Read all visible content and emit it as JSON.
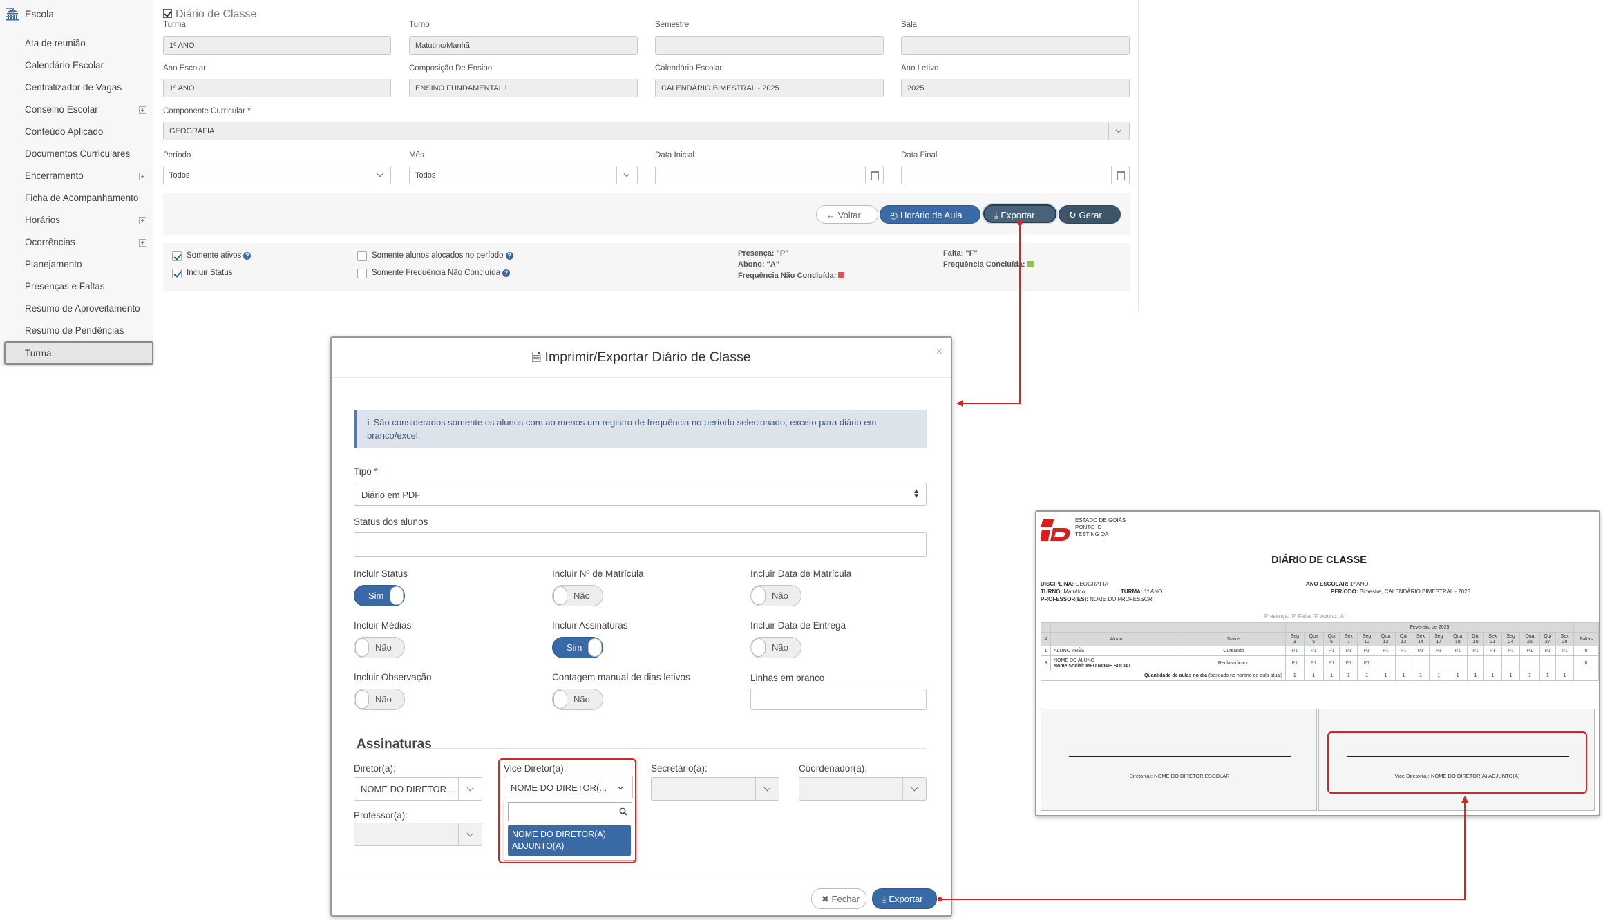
{
  "sidebar": {
    "header": "Escola",
    "items": [
      {
        "label": "Ata de reunião",
        "expandable": false
      },
      {
        "label": "Calendário Escolar",
        "expandable": false
      },
      {
        "label": "Centralizador de Vagas",
        "expandable": false
      },
      {
        "label": "Conselho Escolar",
        "expandable": true
      },
      {
        "label": "Conteúdo Aplicado",
        "expandable": false
      },
      {
        "label": "Documentos Curriculares",
        "expandable": false
      },
      {
        "label": "Encerramento",
        "expandable": true
      },
      {
        "label": "Ficha de Acompanhamento",
        "expandable": false
      },
      {
        "label": "Horários",
        "expandable": true
      },
      {
        "label": "Ocorrências",
        "expandable": true
      },
      {
        "label": "Planejamento",
        "expandable": false
      },
      {
        "label": "Presenças e Faltas",
        "expandable": false
      },
      {
        "label": "Resumo de Aproveitamento",
        "expandable": false
      },
      {
        "label": "Resumo de Pendências",
        "expandable": false
      }
    ],
    "active_item": "Turma"
  },
  "form": {
    "title": "Diário de Classe",
    "turma": {
      "label": "Turma",
      "value": "1º ANO"
    },
    "turno": {
      "label": "Turno",
      "value": "Matutino/Manhã"
    },
    "semestre": {
      "label": "Semestre",
      "value": ""
    },
    "sala": {
      "label": "Sala",
      "value": ""
    },
    "ano_escolar": {
      "label": "Ano Escolar",
      "value": "1º ANO"
    },
    "composicao": {
      "label": "Composição De Ensino",
      "value": "ENSINO FUNDAMENTAL I"
    },
    "calendario": {
      "label": "Calendário Escolar",
      "value": "CALENDÁRIO BIMESTRAL - 2025"
    },
    "ano_letivo": {
      "label": "Ano Letivo",
      "value": "2025"
    },
    "componente": {
      "label": "Componente Curricular",
      "required_mark": "*",
      "value": "GEOGRAFIA"
    },
    "periodo": {
      "label": "Período",
      "value": "Todos"
    },
    "mes": {
      "label": "Mês",
      "value": "Todos"
    },
    "data_inicial": {
      "label": "Data Inicial",
      "value": ""
    },
    "data_final": {
      "label": "Data Final",
      "value": ""
    }
  },
  "buttons": {
    "voltar": "Voltar",
    "horario": "Horário de Aula",
    "exportar": "Exportar",
    "gerar": "Gerar"
  },
  "options": {
    "somente_ativos": {
      "label": "Somente ativos",
      "checked": true
    },
    "incluir_status": {
      "label": "Incluir Status",
      "checked": true
    },
    "somente_alocados": {
      "label": "Somente alunos alocados no período",
      "checked": false
    },
    "somente_freq": {
      "label": "Somente Frequência Não Concluída",
      "checked": false
    }
  },
  "legend": {
    "presenca": "Presença: \"P\"",
    "abono": "Abono: \"A\"",
    "freq_nao_concluida": "Frequência Não Concluída:",
    "falta": "Falta: \"F\"",
    "freq_concluida": "Frequência Concluída:",
    "color_nao_concluida": "#e05252",
    "color_concluida": "#8dc63f"
  },
  "modal": {
    "title": "Imprimir/Exportar Diário de Classe",
    "close": "×",
    "info": "São considerados somente os alunos com ao menos um registro de frequência no período selecionado, exceto para diário em branco/excel.",
    "tipo": {
      "label": "Tipo",
      "required_mark": "*",
      "value": "Diário em PDF"
    },
    "status_alunos": {
      "label": "Status dos alunos",
      "value": ""
    },
    "toggles": [
      {
        "label": "Incluir Status",
        "value": "Sim",
        "on": true
      },
      {
        "label": "Incluir Nº de Matrícula",
        "value": "Não",
        "on": false
      },
      {
        "label": "Incluir Data de Matrícula",
        "value": "Não",
        "on": false
      },
      {
        "label": "Incluir Médias",
        "value": "Não",
        "on": false
      },
      {
        "label": "Incluir Assinaturas",
        "value": "Sim",
        "on": true
      },
      {
        "label": "Incluir Data de Entrega",
        "value": "Não",
        "on": false
      },
      {
        "label": "Incluir Observação",
        "value": "Não",
        "on": false
      },
      {
        "label": "Contagem manual de dias letivos",
        "value": "Não",
        "on": false
      }
    ],
    "linhas_branco": {
      "label": "Linhas em branco",
      "value": ""
    },
    "assinaturas": {
      "title": "Assinaturas",
      "diretor": {
        "label": "Diretor(a):",
        "value": "NOME DO DIRETOR ..."
      },
      "vice": {
        "label": "Vice Diretor(a):",
        "value": "NOME DO DIRETOR(..."
      },
      "secretario": {
        "label": "Secretário(a):",
        "value": ""
      },
      "coordenador": {
        "label": "Coordenador(a):",
        "value": ""
      },
      "professor": {
        "label": "Professor(a):",
        "value": ""
      },
      "dropdown_option": "NOME DO DIRETOR(A) ADJUNTO(A)"
    },
    "fechar": "Fechar",
    "exportar": "Exportar"
  },
  "report": {
    "header_lines": [
      "ESTADO DE GOIÁS",
      "PONTO ID",
      "TESTING QA"
    ],
    "title": "DIÁRIO DE CLASSE",
    "disciplina_label": "DISCIPLINA:",
    "disciplina": "GEOGRAFIA",
    "ano_escolar_label": "ANO ESCOLAR:",
    "ano_escolar": "1º ANO",
    "turno_label": "TURNO:",
    "turno": "Matutino",
    "turma_label": "TURMA:",
    "turma": "1º ANO",
    "periodo_label": "PERÍODO:",
    "periodo": "Bimestre, CALENDÁRIO BIMESTRAL - 2025",
    "professor_label": "PROFESSOR(ES):",
    "professor": "NOME DO PROFESSOR",
    "legend_line": "Presença: 'P'     Falta: 'F'     Abono: 'A'",
    "month": "Fevereiro de 2025",
    "col_num": "#",
    "col_aluno": "Aluno",
    "col_status": "Status",
    "col_faltas": "Faltas",
    "days": [
      {
        "w": "Seg",
        "d": "3"
      },
      {
        "w": "Qua",
        "d": "5"
      },
      {
        "w": "Qui",
        "d": "6"
      },
      {
        "w": "Sex",
        "d": "7"
      },
      {
        "w": "Seg",
        "d": "10"
      },
      {
        "w": "Qua",
        "d": "12"
      },
      {
        "w": "Qui",
        "d": "13"
      },
      {
        "w": "Sex",
        "d": "14"
      },
      {
        "w": "Seg",
        "d": "17"
      },
      {
        "w": "Qua",
        "d": "19"
      },
      {
        "w": "Qui",
        "d": "20"
      },
      {
        "w": "Sex",
        "d": "21"
      },
      {
        "w": "Seg",
        "d": "24"
      },
      {
        "w": "Qua",
        "d": "26"
      },
      {
        "w": "Qui",
        "d": "27"
      },
      {
        "w": "Sex",
        "d": "28"
      }
    ],
    "rows": [
      {
        "num": "1",
        "aluno": "ALUNO TRÊS",
        "social": "",
        "status": "Cursando",
        "marks": [
          "P1",
          "P1",
          "P1",
          "P1",
          "P1",
          "P1",
          "P1",
          "P1",
          "P1",
          "P1",
          "P1",
          "P1",
          "P1",
          "P1",
          "P1",
          "P1"
        ],
        "faltas": "0"
      },
      {
        "num": "3",
        "aluno": "NOME DO ALUNO",
        "social": "Nome Social: MEU NOME SOCIAL",
        "status": "Reclassificado",
        "marks": [
          "P1",
          "P1",
          "P1",
          "P1",
          "P1",
          "",
          "",
          "",
          "",
          "",
          "",
          "",
          "",
          "",
          "",
          ""
        ],
        "faltas": "0"
      }
    ],
    "qtd_label": "Quantidade de aulas no dia",
    "qtd_note": "(baseado no horário de aula atual)",
    "qtd_values": [
      "1",
      "1",
      "1",
      "1",
      "1",
      "1",
      "1",
      "1",
      "1",
      "1",
      "1",
      "1",
      "1",
      "1",
      "1",
      "1"
    ],
    "sig_diretor": "Diretor(a): NOME DO DIRETOR ESCOLAR",
    "sig_vice": "Vice Diretor(a): NOME DO DIRETOR(A) ADJUNTO(A)"
  },
  "colors": {
    "accent": "#3a6aa6",
    "highlight": "#dd2222"
  }
}
